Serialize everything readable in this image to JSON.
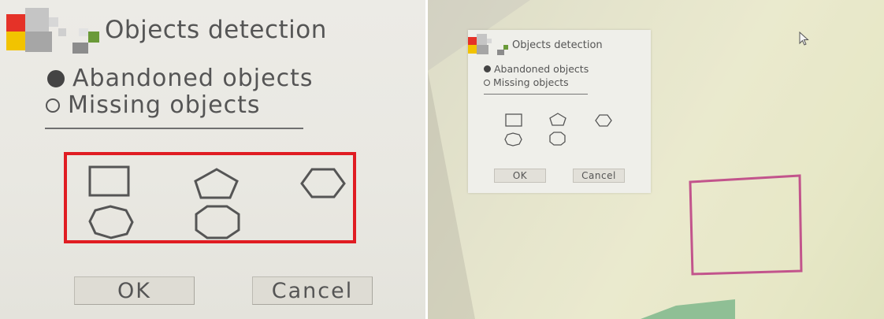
{
  "dialog": {
    "title": "Objects detection",
    "options": [
      {
        "label": "Abandoned objects",
        "selected": true
      },
      {
        "label": "Missing objects",
        "selected": false
      }
    ],
    "shapes": [
      "rectangle",
      "pentagon",
      "hexagon",
      "heptagon",
      "octagon"
    ],
    "ok_label": "OK",
    "cancel_label": "Cancel"
  },
  "icons": {
    "logo": "mosaic-logo-icon",
    "cursor": "mouse-pointer-icon"
  },
  "colors": {
    "highlight_box": "#e01c22",
    "detection_box": "#c2548c",
    "logo_red": "#e53228",
    "logo_yellow": "#f2c300",
    "logo_green": "#6a9a38"
  }
}
